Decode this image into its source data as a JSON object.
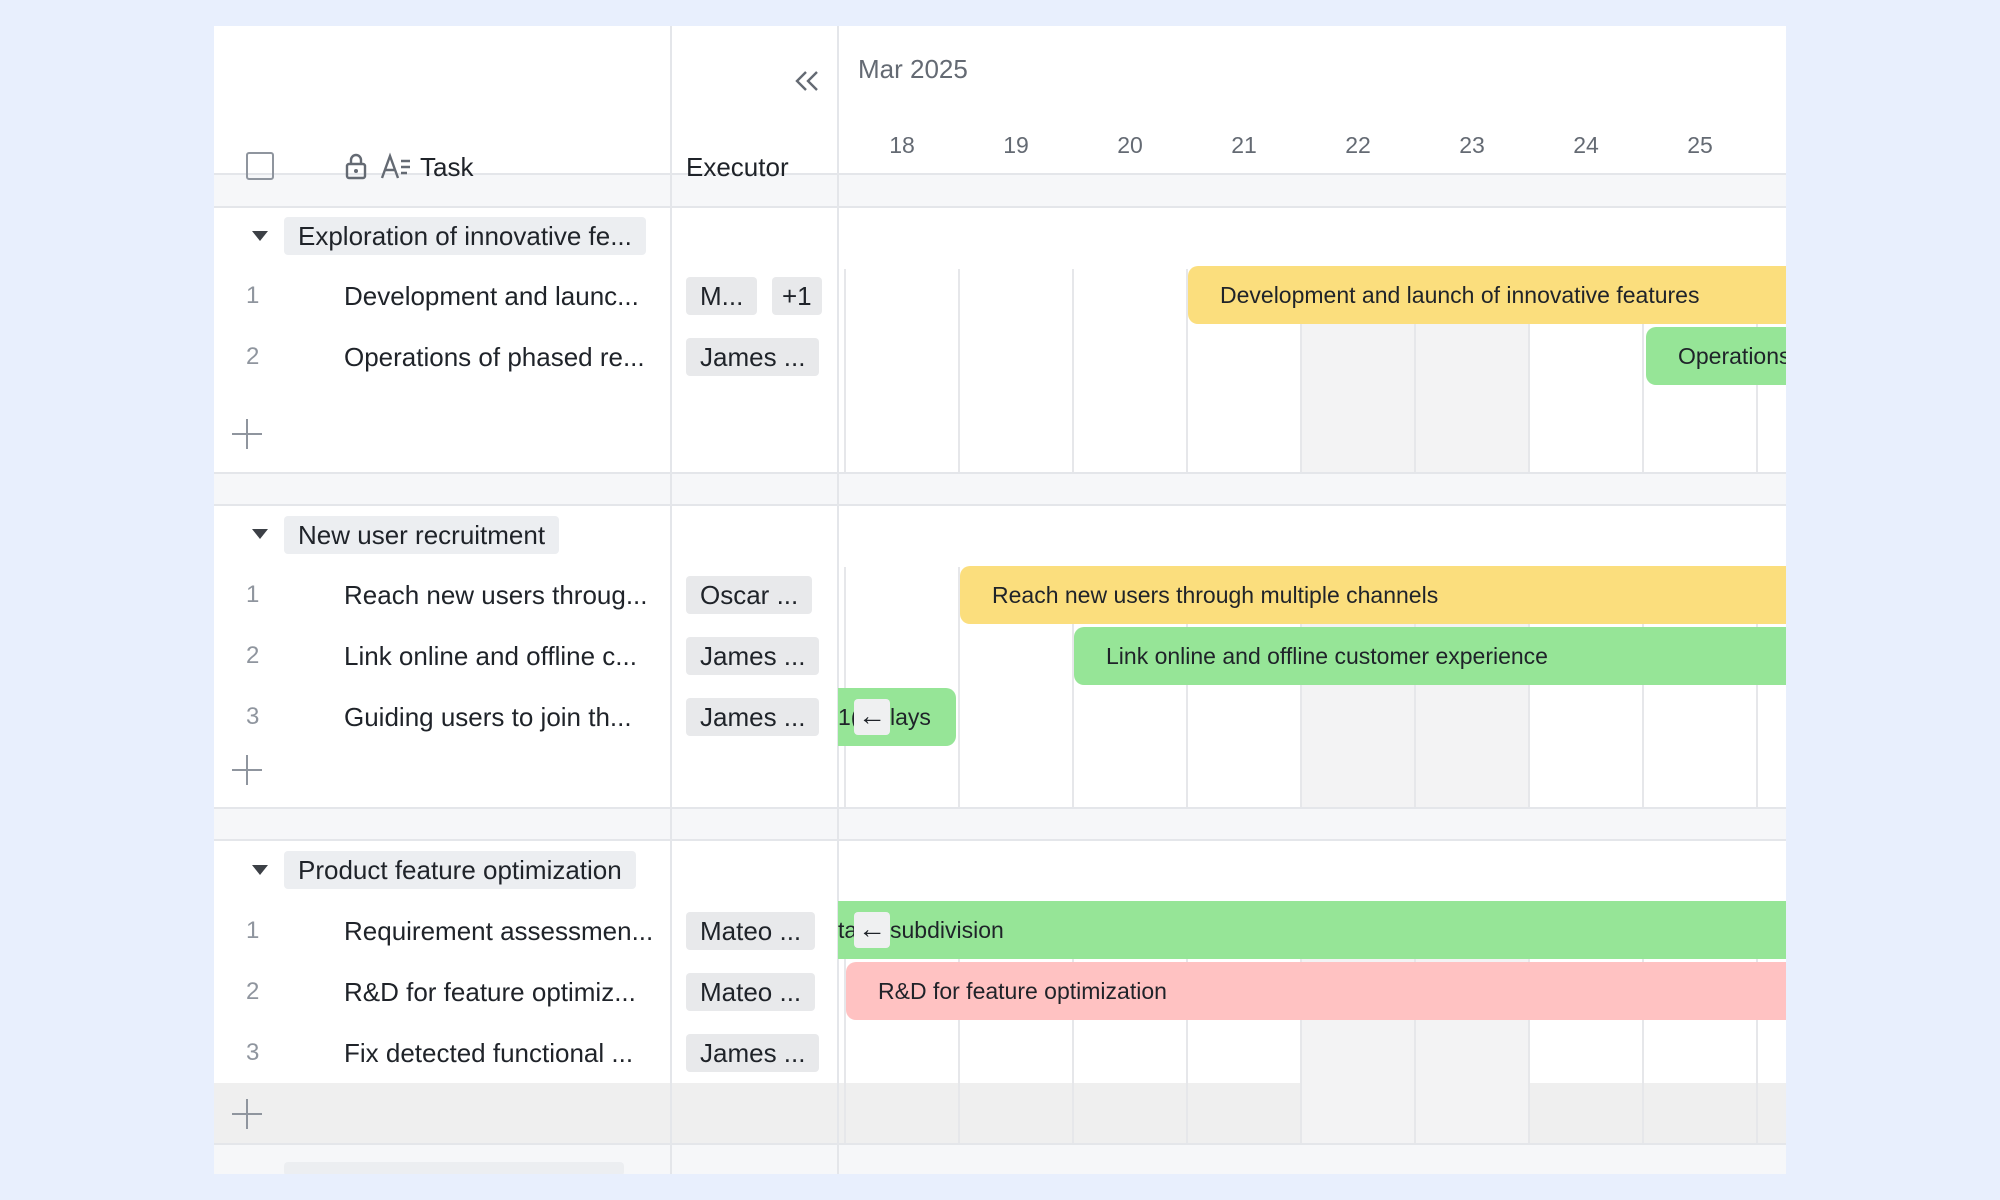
{
  "header": {
    "task_label": "Task",
    "executor_label": "Executor",
    "month": "Mar 2025",
    "days": [
      "18",
      "19",
      "20",
      "21",
      "22",
      "23",
      "24",
      "25"
    ]
  },
  "groups": [
    {
      "title": "Exploration of innovative fe...",
      "rows": [
        {
          "num": "1",
          "title": "Development and launc...",
          "executors": [
            "M...",
            "+1"
          ]
        },
        {
          "num": "2",
          "title": "Operations of phased re...",
          "executors": [
            "James ..."
          ]
        }
      ]
    },
    {
      "title": "New user recruitment",
      "rows": [
        {
          "num": "1",
          "title": "Reach new users throug...",
          "executors": [
            "Oscar ..."
          ]
        },
        {
          "num": "2",
          "title": "Link online and offline c...",
          "executors": [
            "James ..."
          ]
        },
        {
          "num": "3",
          "title": "Guiding users to join th...",
          "executors": [
            "James ..."
          ]
        }
      ]
    },
    {
      "title": "Product feature optimization",
      "rows": [
        {
          "num": "1",
          "title": "Requirement assessmen...",
          "executors": [
            "Mateo ..."
          ]
        },
        {
          "num": "2",
          "title": "R&D for feature optimiz...",
          "executors": [
            "Mateo ..."
          ]
        },
        {
          "num": "3",
          "title": "Fix detected functional ...",
          "executors": [
            "James ..."
          ]
        }
      ]
    }
  ],
  "bars": [
    {
      "label": "Development and launch of innovative features",
      "color": "yellow"
    },
    {
      "label": "Operations",
      "color": "green"
    },
    {
      "label": "Reach new users through multiple channels",
      "color": "yellow"
    },
    {
      "label": "Link online and offline customer experience",
      "color": "green"
    },
    {
      "label": "1(",
      "label2": "lays",
      "color": "green"
    },
    {
      "label": "ta",
      "label2": "subdivision",
      "color": "green"
    },
    {
      "label": "R&D for feature optimization",
      "color": "pink"
    }
  ],
  "icons": {
    "collapse": "double-chevron-left",
    "lock": "lock",
    "text_type": "text-field-type",
    "expand_group": "caret-down",
    "add": "plus",
    "jump": "arrow-left"
  },
  "colors": {
    "background": "#e8effd",
    "bar_yellow": "#fbde7d",
    "bar_green": "#96e597",
    "bar_pink": "#ffc2c2",
    "weekend_shade": "#f3f3f4"
  }
}
